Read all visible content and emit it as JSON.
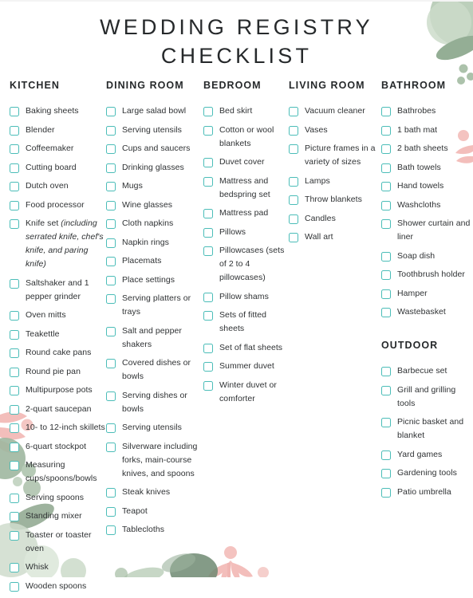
{
  "title": "WEDDING REGISTRY\nCHECKLIST",
  "theme": {
    "checkbox_border": "#4bbdb8",
    "text": "#2f3234",
    "heading": "#26292b",
    "sage": "#9cb5a0",
    "sage_light": "#c3d3c4",
    "sage_pale": "#dfe8de",
    "blush": "#f3bfbc",
    "blush_light": "#f7d4d1"
  },
  "columns": [
    {
      "id": "kitchen",
      "heading": "KITCHEN",
      "items": [
        {
          "text": "Baking sheets"
        },
        {
          "text": "Blender"
        },
        {
          "text": "Coffeemaker"
        },
        {
          "text": "Cutting board"
        },
        {
          "text": "Dutch oven"
        },
        {
          "text": "Food processor"
        },
        {
          "text": "Knife set ",
          "emphasis": "(including serrated knife, chef's knife, and paring knife)"
        },
        {
          "text": "Saltshaker and 1 pepper grinder"
        },
        {
          "text": "Oven mitts"
        },
        {
          "text": "Teakettle"
        },
        {
          "text": "Round cake pans"
        },
        {
          "text": "Round pie pan"
        },
        {
          "text": "Multipurpose pots"
        },
        {
          "text": "2-quart saucepan"
        },
        {
          "text": "10- to 12-inch skillets"
        },
        {
          "text": "6-quart stockpot"
        },
        {
          "text": "Measuring cups/spoons/bowls"
        },
        {
          "text": "Serving spoons"
        },
        {
          "text": "Standing mixer"
        },
        {
          "text": "Toaster or toaster oven"
        },
        {
          "text": "Whisk"
        },
        {
          "text": "Wooden spoons"
        }
      ]
    },
    {
      "id": "dining-room",
      "heading": "DINING ROOM",
      "items": [
        {
          "text": "Large salad bowl"
        },
        {
          "text": "Serving utensils"
        },
        {
          "text": "Cups and saucers"
        },
        {
          "text": "Drinking glasses"
        },
        {
          "text": "Mugs"
        },
        {
          "text": "Wine glasses"
        },
        {
          "text": "Cloth napkins"
        },
        {
          "text": "Napkin rings"
        },
        {
          "text": "Placemats"
        },
        {
          "text": "Place settings"
        },
        {
          "text": "Serving platters or trays"
        },
        {
          "text": "Salt and pepper shakers"
        },
        {
          "text": "Covered dishes or bowls"
        },
        {
          "text": "Serving dishes or bowls"
        },
        {
          "text": "Serving utensils"
        },
        {
          "text": "Silverware including forks, main-course knives, and spoons"
        },
        {
          "text": "Steak knives"
        },
        {
          "text": "Teapot"
        },
        {
          "text": "Tablecloths"
        }
      ]
    },
    {
      "id": "bedroom",
      "heading": "BEDROOM",
      "items": [
        {
          "text": "Bed skirt"
        },
        {
          "text": "Cotton or wool blankets"
        },
        {
          "text": "Duvet cover"
        },
        {
          "text": "Mattress and bedspring set"
        },
        {
          "text": "Mattress pad"
        },
        {
          "text": "Pillows"
        },
        {
          "text": "Pillowcases (sets of 2 to 4 pillowcases)"
        },
        {
          "text": "Pillow shams"
        },
        {
          "text": "Sets of fitted sheets"
        },
        {
          "text": "Set of flat sheets"
        },
        {
          "text": "Summer duvet"
        },
        {
          "text": "Winter duvet or comforter"
        }
      ]
    },
    {
      "id": "living-room",
      "heading": "LIVING ROOM",
      "items": [
        {
          "text": "Vacuum cleaner"
        },
        {
          "text": "Vases"
        },
        {
          "text": "Picture frames in a variety of sizes"
        },
        {
          "text": "Lamps"
        },
        {
          "text": "Throw blankets"
        },
        {
          "text": "Candles"
        },
        {
          "text": "Wall art"
        }
      ]
    },
    {
      "id": "bathroom",
      "heading": "BATHROOM",
      "items": [
        {
          "text": "Bathrobes"
        },
        {
          "text": "1 bath mat"
        },
        {
          "text": "2 bath sheets"
        },
        {
          "text": "Bath towels"
        },
        {
          "text": "Hand towels"
        },
        {
          "text": "Washcloths"
        },
        {
          "text": "Shower curtain and liner"
        },
        {
          "text": "Soap dish"
        },
        {
          "text": "Toothbrush holder"
        },
        {
          "text": "Hamper"
        },
        {
          "text": "Wastebasket"
        }
      ],
      "sub_section": {
        "id": "outdoor",
        "heading": "OUTDOOR",
        "items": [
          {
            "text": "Barbecue set"
          },
          {
            "text": "Grill and grilling tools"
          },
          {
            "text": "Picnic basket and blanket"
          },
          {
            "text": "Yard games"
          },
          {
            "text": "Gardening tools"
          },
          {
            "text": "Patio umbrella"
          }
        ]
      }
    }
  ]
}
